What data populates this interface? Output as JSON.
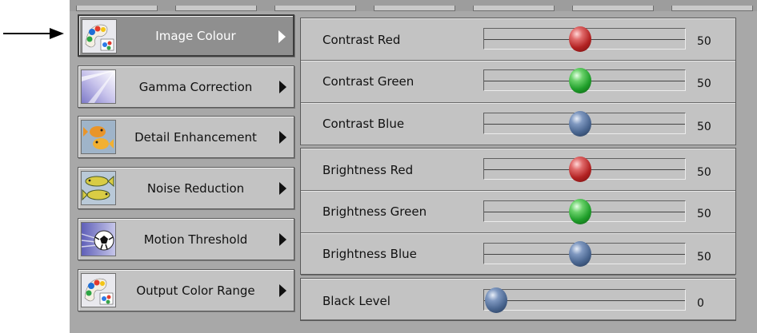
{
  "menu": {
    "items": [
      {
        "label": "Image Colour",
        "selected": true,
        "icon": "color-palette-icon"
      },
      {
        "label": "Gamma Correction",
        "selected": false,
        "icon": "light-burst-icon"
      },
      {
        "label": "Detail Enhancement",
        "selected": false,
        "icon": "goldfish-icon"
      },
      {
        "label": "Noise Reduction",
        "selected": false,
        "icon": "fish-pair-icon"
      },
      {
        "label": "Motion Threshold",
        "selected": false,
        "icon": "soccer-ball-icon"
      },
      {
        "label": "Output Color Range",
        "selected": false,
        "icon": "color-palette-icon"
      }
    ]
  },
  "contrast": {
    "red": {
      "label": "Contrast Red",
      "value": "50",
      "knob": "red"
    },
    "green": {
      "label": "Contrast Green",
      "value": "50",
      "knob": "green"
    },
    "blue": {
      "label": "Contrast Blue",
      "value": "50",
      "knob": "blue"
    }
  },
  "brightness": {
    "red": {
      "label": "Brightness Red",
      "value": "50",
      "knob": "red"
    },
    "green": {
      "label": "Brightness Green",
      "value": "50",
      "knob": "green"
    },
    "blue": {
      "label": "Brightness Blue",
      "value": "50",
      "knob": "blue"
    }
  },
  "black_level": {
    "label": "Black Level",
    "value": "0",
    "knob": "blue"
  },
  "colors": {
    "frame": "#a8a8a8",
    "panel": "#c3c3c3",
    "selected": "#8f8f8f"
  }
}
